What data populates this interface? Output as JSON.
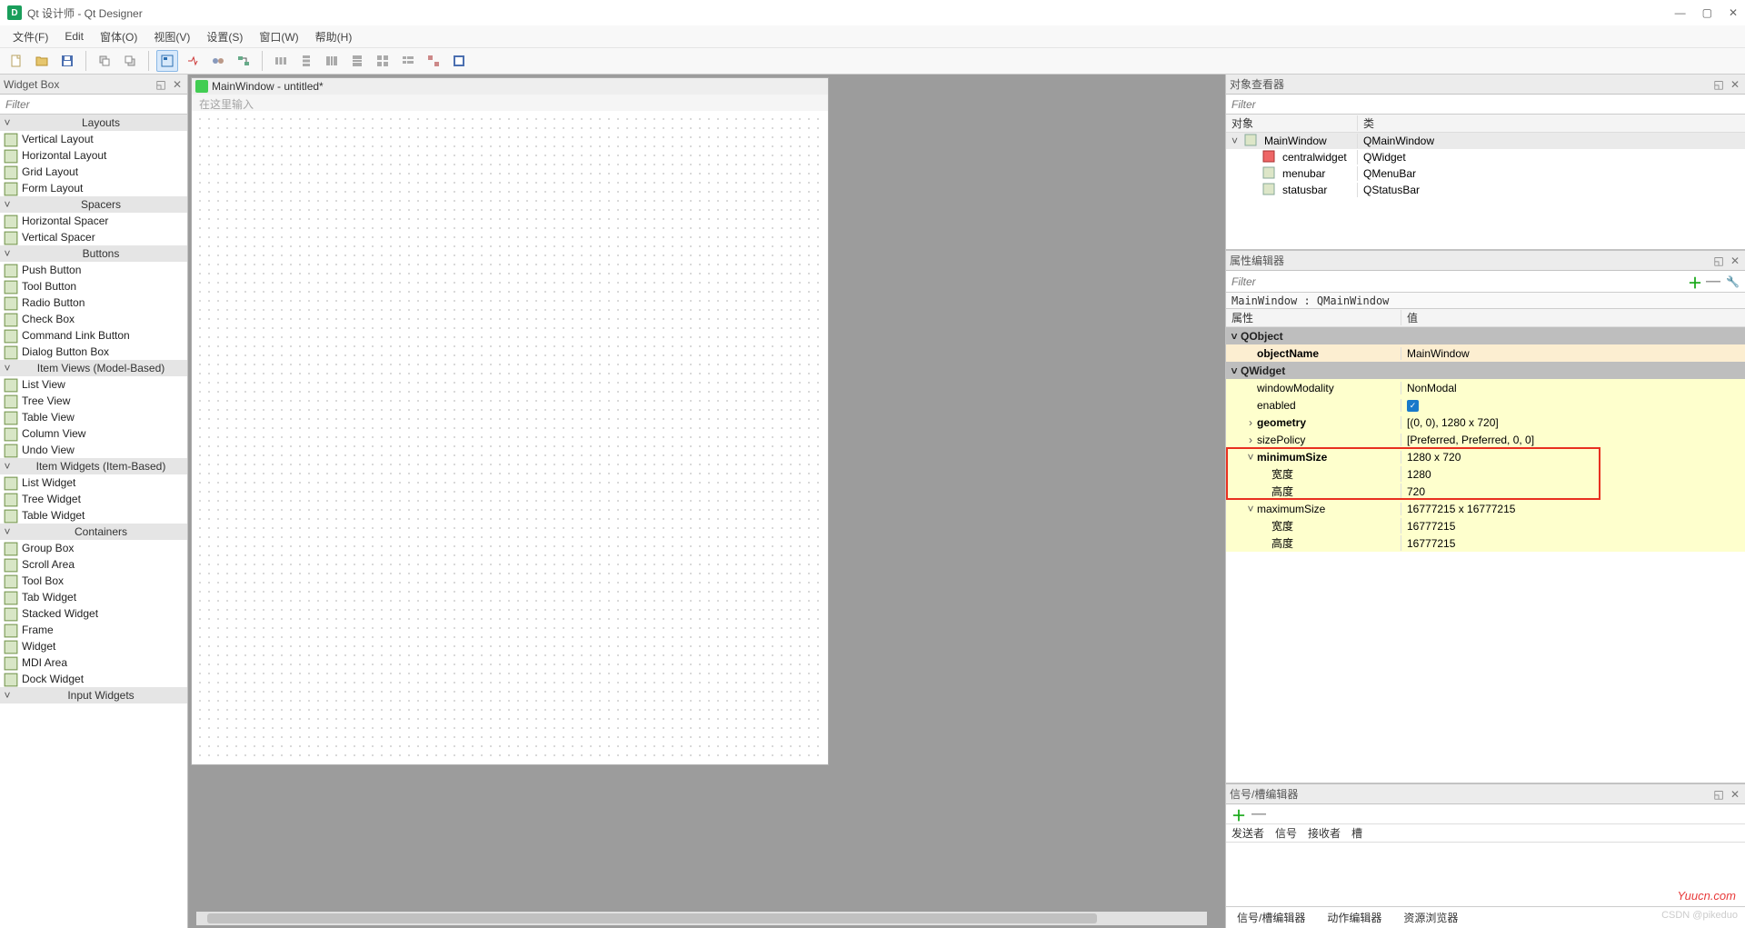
{
  "title": "Qt 设计师 - Qt Designer",
  "menubar": [
    "文件(F)",
    "Edit",
    "窗体(O)",
    "视图(V)",
    "设置(S)",
    "窗口(W)",
    "帮助(H)"
  ],
  "widget_box": {
    "title": "Widget Box",
    "filter": "Filter",
    "groups": [
      {
        "name": "Layouts",
        "items": [
          "Vertical Layout",
          "Horizontal Layout",
          "Grid Layout",
          "Form Layout"
        ]
      },
      {
        "name": "Spacers",
        "items": [
          "Horizontal Spacer",
          "Vertical Spacer"
        ]
      },
      {
        "name": "Buttons",
        "items": [
          "Push Button",
          "Tool Button",
          "Radio Button",
          "Check Box",
          "Command Link Button",
          "Dialog Button Box"
        ]
      },
      {
        "name": "Item Views (Model-Based)",
        "items": [
          "List View",
          "Tree View",
          "Table View",
          "Column View",
          "Undo View"
        ]
      },
      {
        "name": "Item Widgets (Item-Based)",
        "items": [
          "List Widget",
          "Tree Widget",
          "Table Widget"
        ]
      },
      {
        "name": "Containers",
        "items": [
          "Group Box",
          "Scroll Area",
          "Tool Box",
          "Tab Widget",
          "Stacked Widget",
          "Frame",
          "Widget",
          "MDI Area",
          "Dock Widget"
        ]
      },
      {
        "name": "Input Widgets",
        "items": []
      }
    ]
  },
  "center": {
    "form_title": "MainWindow - untitled*",
    "menu_hint": "在这里输入"
  },
  "object_viewer": {
    "title": "对象查看器",
    "filter": "Filter",
    "col1": "对象",
    "col2": "类",
    "rows": [
      {
        "name": "MainWindow",
        "cls": "QMainWindow",
        "indent": 0,
        "sel": true,
        "arrow": "˅"
      },
      {
        "name": "centralwidget",
        "cls": "QWidget",
        "indent": 1,
        "icon": "red"
      },
      {
        "name": "menubar",
        "cls": "QMenuBar",
        "indent": 1
      },
      {
        "name": "statusbar",
        "cls": "QStatusBar",
        "indent": 1
      }
    ]
  },
  "prop_editor": {
    "title": "属性编辑器",
    "filter": "Filter",
    "context": "MainWindow : QMainWindow",
    "col1": "属性",
    "col2": "值",
    "sections": [
      {
        "label": "QObject",
        "rows": [
          {
            "name": "objectName",
            "value": "MainWindow",
            "bold": true,
            "tone": "orange",
            "indent": 1
          }
        ]
      },
      {
        "label": "QWidget",
        "rows": [
          {
            "name": "windowModality",
            "value": "NonModal",
            "tone": "yellow",
            "indent": 1
          },
          {
            "name": "enabled",
            "value": "✓",
            "check": true,
            "tone": "yellow",
            "indent": 1
          },
          {
            "name": "geometry",
            "value": "[(0, 0), 1280 x 720]",
            "bold": true,
            "tone": "yellow",
            "indent": 1,
            "arrow": "›"
          },
          {
            "name": "sizePolicy",
            "value": "[Preferred, Preferred, 0, 0]",
            "tone": "yellow",
            "indent": 1,
            "arrow": "›"
          },
          {
            "name": "minimumSize",
            "value": "1280 x 720",
            "bold": true,
            "tone": "yellow",
            "indent": 1,
            "arrow": "˅",
            "hl": true
          },
          {
            "name": "宽度",
            "value": "1280",
            "tone": "yellow",
            "indent": 2,
            "hl": true
          },
          {
            "name": "高度",
            "value": "720",
            "tone": "yellow",
            "indent": 2,
            "hl": true
          },
          {
            "name": "maximumSize",
            "value": "16777215 x 16777215",
            "tone": "yellow",
            "indent": 1,
            "arrow": "˅"
          },
          {
            "name": "宽度",
            "value": "16777215",
            "tone": "yellow",
            "indent": 2
          },
          {
            "name": "高度",
            "value": "16777215",
            "tone": "yellow",
            "indent": 2
          }
        ]
      }
    ]
  },
  "signals": {
    "title": "信号/槽编辑器",
    "cols": [
      "发送者",
      "信号",
      "接收者",
      "槽"
    ]
  },
  "bottom_tabs": [
    "信号/槽编辑器",
    "动作编辑器",
    "资源浏览器"
  ],
  "watermark": "Yuucn.com",
  "csdn": "CSDN @pikeduo"
}
